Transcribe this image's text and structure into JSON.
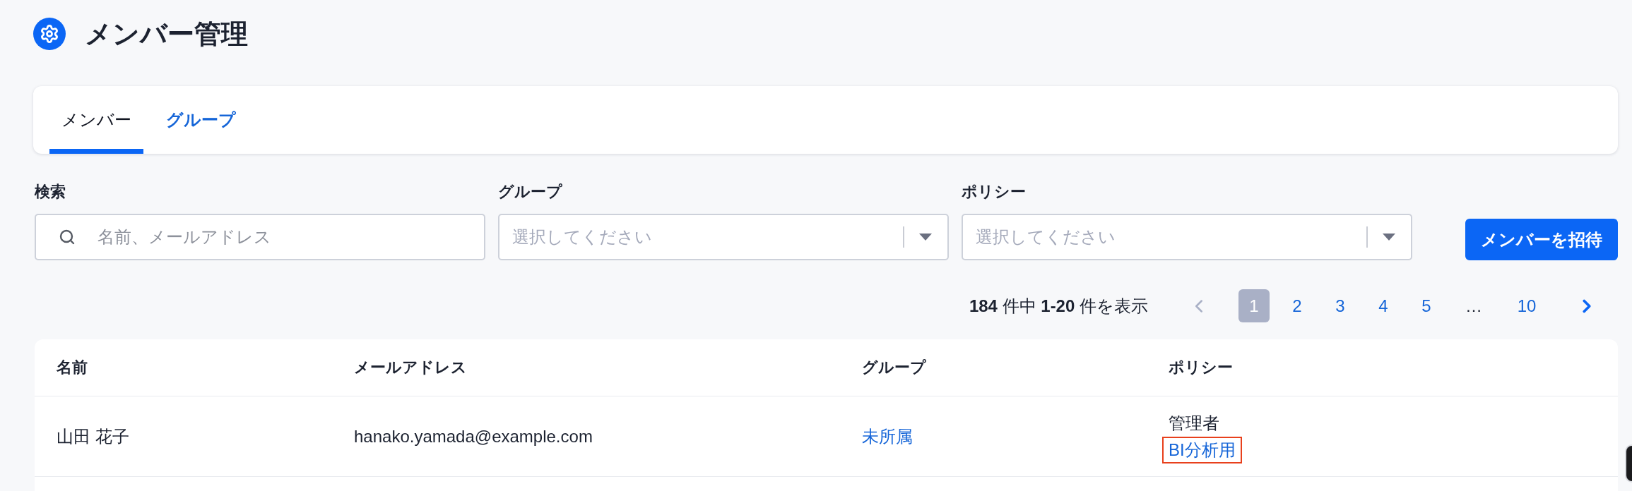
{
  "header": {
    "title": "メンバー管理"
  },
  "tabs": [
    {
      "label": "メンバー",
      "selected": true
    },
    {
      "label": "グループ",
      "selected": false
    }
  ],
  "filters": [
    {
      "kind": "search",
      "label": "検索",
      "placeholder": "名前、メールアドレス"
    },
    {
      "kind": "select",
      "label": "グループ",
      "placeholder": "選択してください"
    },
    {
      "kind": "select",
      "label": "ポリシー",
      "placeholder": "選択してください"
    }
  ],
  "invite_button": "メンバーを招待",
  "pagination": {
    "summary": "**184** 件中 **1-20** 件を表示",
    "prev": {
      "disabled": true
    },
    "pages": [
      {
        "kind": "page",
        "label": "1",
        "selected": true
      },
      {
        "kind": "page",
        "label": "2",
        "selected": false
      },
      {
        "kind": "page",
        "label": "3",
        "selected": false
      },
      {
        "kind": "page",
        "label": "4",
        "selected": false
      },
      {
        "kind": "page",
        "label": "5",
        "selected": false
      },
      {
        "kind": "ellipsis",
        "label": "…",
        "selected": false
      },
      {
        "kind": "page",
        "label": "10",
        "selected": false
      }
    ],
    "next": {
      "disabled": false
    }
  },
  "table": {
    "columns": [
      "名前",
      "メールアドレス",
      "グループ",
      "ポリシー"
    ],
    "rows": [
      {
        "name": "山田 花子",
        "email": "hanako.yamada@example.com",
        "group": "未所属",
        "policies": [
          {
            "kind": "text",
            "label": "管理者",
            "highlighted": false
          },
          {
            "kind": "link",
            "label": "BI分析用",
            "highlighted": true
          }
        ]
      }
    ]
  }
}
